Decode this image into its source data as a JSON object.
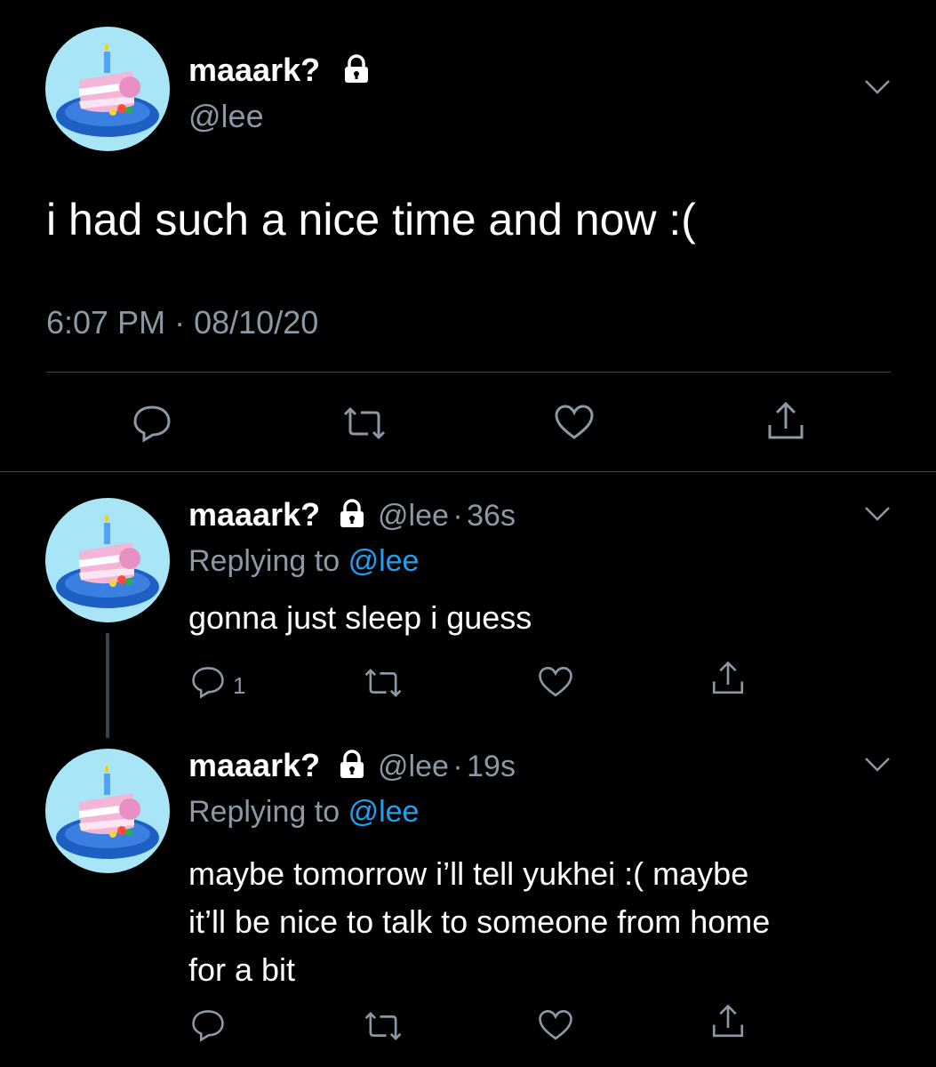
{
  "main_tweet": {
    "display_name": "maaark?",
    "handle": "@lee",
    "text": "i had such a nice time and now :(",
    "time": "6:07 PM",
    "separator": "·",
    "date": "08/10/20",
    "lock_icon": "lock-icon",
    "actions": [
      "reply-icon",
      "retweet-icon",
      "like-icon",
      "share-icon"
    ]
  },
  "replies": [
    {
      "display_name": "maaark?",
      "handle": "@lee",
      "dot": "·",
      "age": "36s",
      "replying_prefix": "Replying to",
      "replying_handle": "@lee",
      "text": "gonna just sleep i guess",
      "reply_count": "1"
    },
    {
      "display_name": "maaark?",
      "handle": "@lee",
      "dot": "·",
      "age": "19s",
      "replying_prefix": "Replying to",
      "replying_handle": "@lee",
      "text_lines": [
        "maybe tomorrow i’ll tell yukhei :( maybe",
        "it’ll be nice to talk to someone from home",
        "for a bit"
      ]
    }
  ],
  "colors": {
    "background": "#000000",
    "muted": "#8b98a5",
    "link": "#1da1f2",
    "avatar_bg": "#a8e6f7",
    "divider": "#38444d"
  }
}
